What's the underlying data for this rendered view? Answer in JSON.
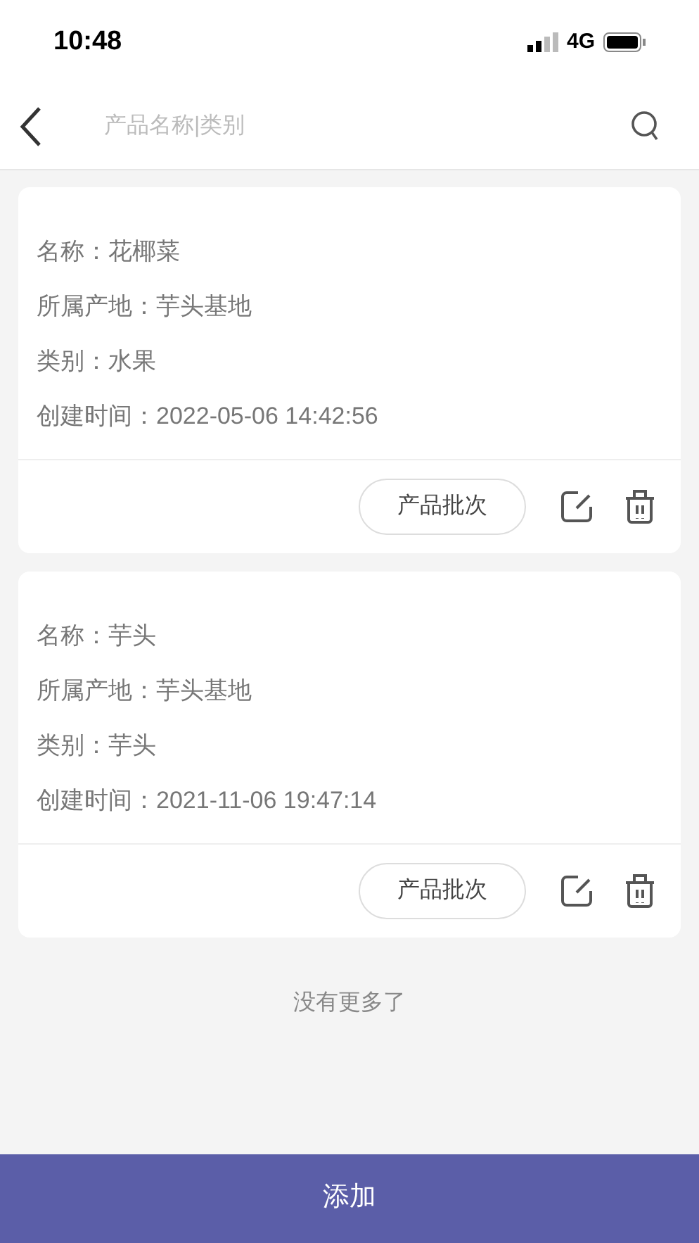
{
  "status_bar": {
    "time": "10:48",
    "network": "4G"
  },
  "search": {
    "placeholder": "产品名称|类别"
  },
  "products": [
    {
      "lines": [
        "名称：花椰菜",
        "所属产地：芋头基地",
        "类别：水果",
        "创建时间：2022-05-06 14:42:56"
      ],
      "batch_button": "产品批次"
    },
    {
      "lines": [
        "名称：芋头",
        "所属产地：芋头基地",
        "类别：芋头",
        "创建时间：2021-11-06 19:47:14"
      ],
      "batch_button": "产品批次"
    }
  ],
  "end_note": "没有更多了",
  "add_button": "添加"
}
